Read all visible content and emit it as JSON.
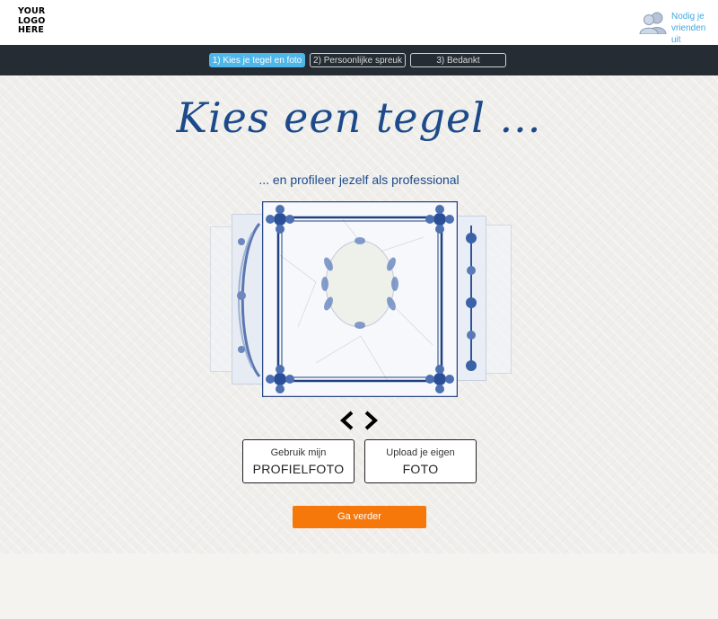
{
  "brand": {
    "logo_lines": [
      "YOUR",
      "LOGO",
      "HERE"
    ]
  },
  "header": {
    "invite_line1": "Nodig je",
    "invite_line2": "vrienden uit",
    "invite_icon": "friends-icon"
  },
  "steps": [
    {
      "label": "1) Kies je tegel en foto",
      "active": true
    },
    {
      "label": "2) Persoonlijke spreuk",
      "active": false
    },
    {
      "label": "3) Bedankt",
      "active": false
    }
  ],
  "main": {
    "title": "Kies een tegel ...",
    "subtitle": "... en profileer jezelf als professional"
  },
  "carousel": {
    "prev_icon": "chevron-left-icon",
    "next_icon": "chevron-right-icon"
  },
  "choices": [
    {
      "small": "Gebruik mijn",
      "big": "PROFIELFOTO"
    },
    {
      "small": "Upload je eigen",
      "big": "FOTO"
    }
  ],
  "cta": {
    "label": "Ga verder"
  },
  "colors": {
    "accent": "#4fb6ea",
    "navy": "#1c4a8a",
    "cta": "#f6780b",
    "stepbar": "#262c33"
  }
}
